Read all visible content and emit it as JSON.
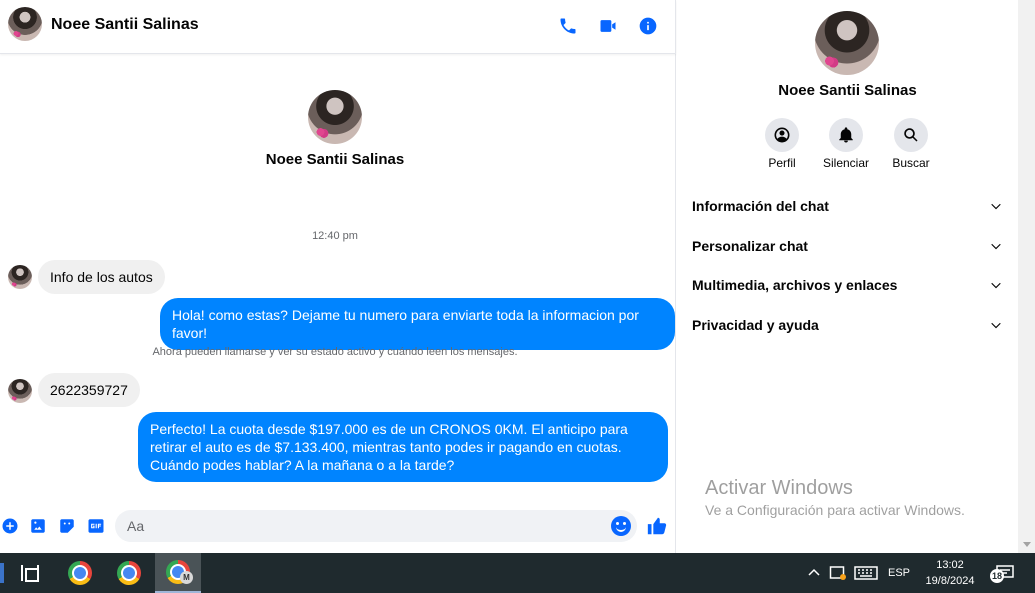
{
  "contact": {
    "name": "Noee Santii Salinas"
  },
  "chat": {
    "timestamp": "12:40 pm",
    "messages": [
      {
        "dir": "in",
        "text": "Info de los autos"
      },
      {
        "dir": "out",
        "text": "Hola! como estas? Dejame tu numero para enviarte toda la informacion por favor!"
      },
      {
        "dir": "in",
        "text": "2622359727"
      },
      {
        "dir": "out",
        "text": "Perfecto! La cuota desde $197.000 es de un CRONOS 0KM. El anticipo para retirar el auto es de $7.133.400, mientras tanto podes ir pagando en cuotas. Cuándo podes hablar? A la mañana o a la tarde?"
      }
    ],
    "notice": "Ahora pueden llamarse y ver su estado activo y cuándo leen los mensajes.",
    "composer": {
      "placeholder": "Aa"
    }
  },
  "info_panel": {
    "actions": [
      {
        "label": "Perfil",
        "icon": "profile-icon"
      },
      {
        "label": "Silenciar",
        "icon": "bell-icon"
      },
      {
        "label": "Buscar",
        "icon": "search-icon"
      }
    ],
    "sections": [
      "Información del chat",
      "Personalizar chat",
      "Multimedia, archivos y enlaces",
      "Privacidad y ayuda"
    ]
  },
  "watermark": {
    "title": "Activar Windows",
    "subtitle": "Ve a Configuración para activar Windows."
  },
  "taskbar": {
    "language": "ESP",
    "time": "13:02",
    "date": "19/8/2024",
    "notification_count": "18",
    "chrome_badge": "M"
  },
  "colors": {
    "accent": "#0866ff",
    "outgoing_bubble": "#0084ff",
    "incoming_bubble": "#f0f0f0",
    "taskbar": "#1f2a2e"
  }
}
